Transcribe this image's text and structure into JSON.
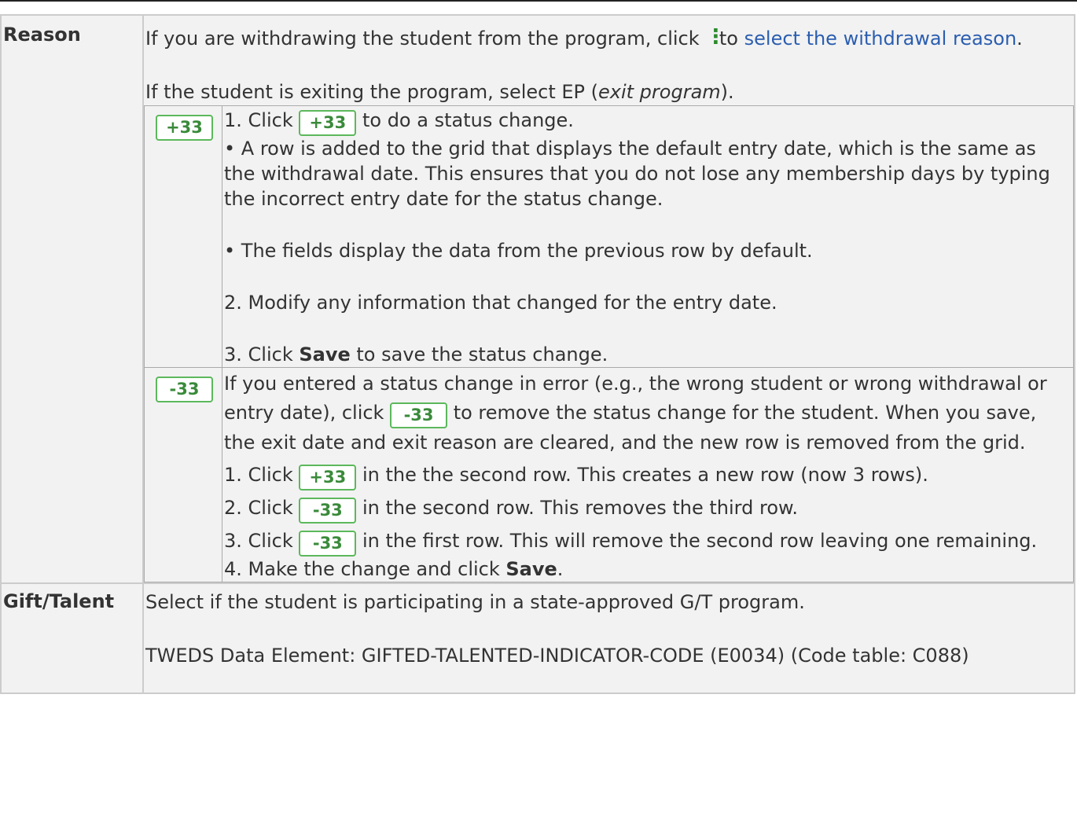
{
  "rows": {
    "reason": {
      "label": "Reason",
      "intro_before": "If you are withdrawing the student from the program, click ",
      "intro_mid": " to ",
      "intro_link": "select the withdrawal reason",
      "intro_after": ".",
      "exit_before": "If the student is exiting the program, select EP (",
      "exit_italic": "exit program",
      "exit_after": ").",
      "kebab_icon": "more-vertical-icon"
    },
    "gift": {
      "label": "Gift/Talent",
      "line1": "Select if the student is participating in a state-approved G/T program.",
      "line2": "TWEDS Data Element: GIFTED-TALENTED-INDICATOR-CODE (E0034) (Code table: C088)"
    }
  },
  "buttons": {
    "add": "+33",
    "remove": "-33"
  },
  "add_section": {
    "step1_a": "1. Click ",
    "step1_b": " to do a status change.",
    "bullet1": "• A row is added to the grid that displays the default entry date, which is the same as the withdrawal date. This ensures that you do not lose any membership days by typing the incorrect entry date for the status change.",
    "bullet2": "• The fields display the data from the previous row by default.",
    "step2": "2. Modify any information that changed for the entry date.",
    "step3_a": "3. Click ",
    "step3_bold": "Save",
    "step3_b": " to save the status change."
  },
  "remove_section": {
    "intro_a": "If you entered a status change in error (e.g., the wrong student or wrong withdrawal or entry date), click ",
    "intro_b": " to remove the status change for the student. When you save, the exit date and exit reason are cleared, and the new row is removed from the grid.",
    "s1_a": "1. Click ",
    "s1_b": " in the the second row. This creates a new row (now 3 rows).",
    "s2_a": "2. Click ",
    "s2_b": " in the second row. This removes the third row.",
    "s3_a": "3. Click ",
    "s3_b": " in the first row. This will remove the second row leaving one remaining.",
    "s4_a": "4. Make the change and click ",
    "s4_bold": "Save",
    "s4_b": "."
  }
}
